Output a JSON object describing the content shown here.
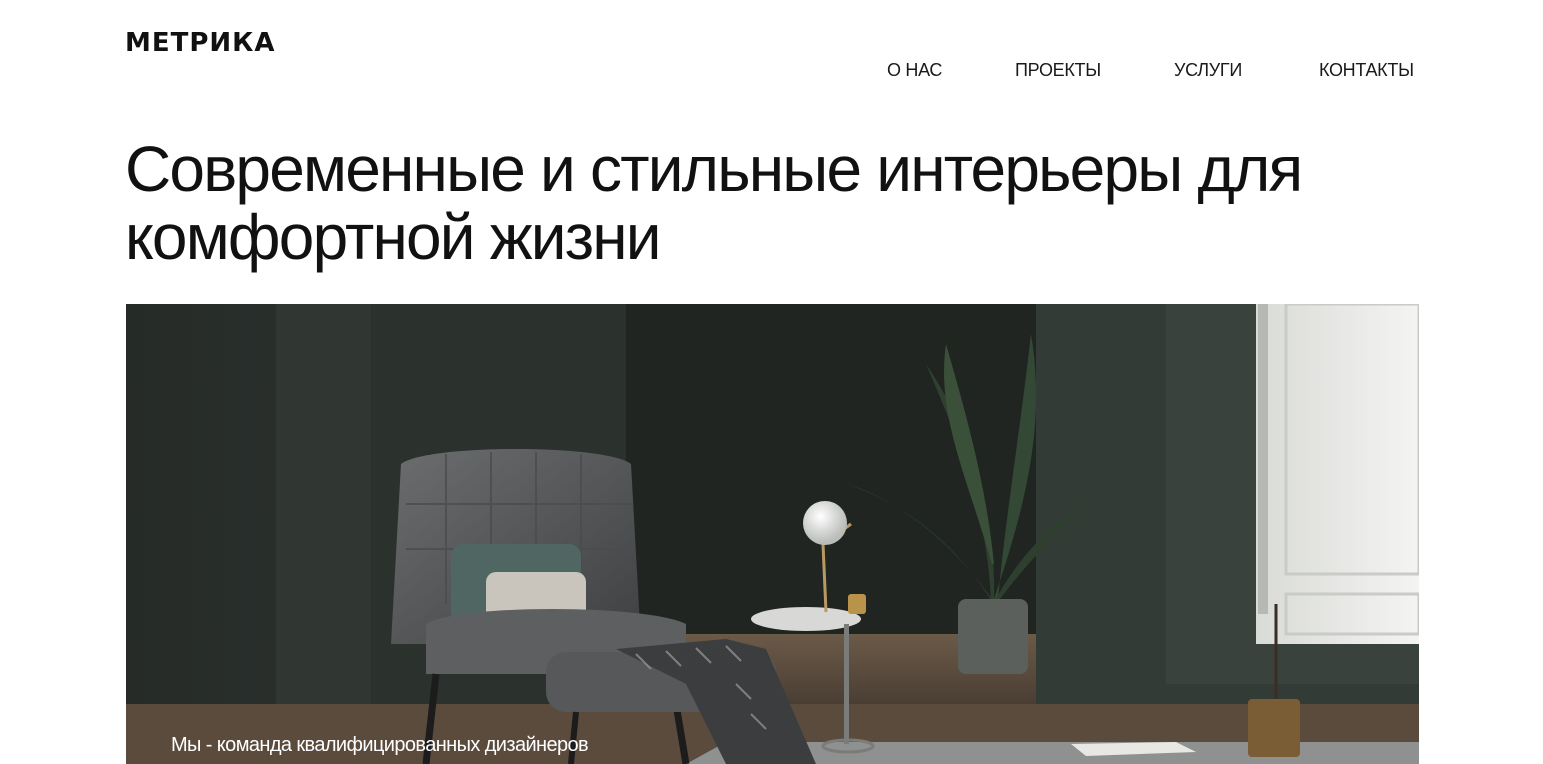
{
  "header": {
    "logo_text": "МЕТРИКА",
    "nav": [
      {
        "label": "О НАС"
      },
      {
        "label": "ПРОЕКТЫ"
      },
      {
        "label": "УСЛУГИ"
      },
      {
        "label": "КОНТАКТЫ"
      }
    ]
  },
  "hero": {
    "title": "Современные и стильные интерьеры для комфортной жизни",
    "caption": "Мы - команда квалифицированных дизайнеров"
  },
  "colors": {
    "background": "#ffffff",
    "text": "#111111",
    "hero_wall": "#2f3632",
    "hero_wall_dark": "#232825",
    "hero_panel_light": "#e9eae7"
  }
}
